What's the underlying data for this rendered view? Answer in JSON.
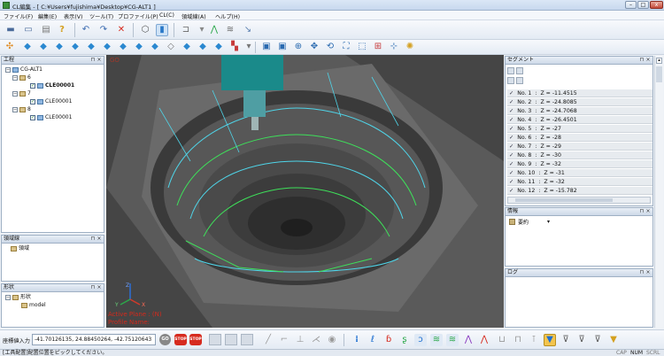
{
  "window": {
    "title": "CL編集 - [ C:¥Users¥fujishima¥Desktop¥CG-ALT1 ]",
    "min_label": "–",
    "max_label": "□",
    "close_label": "x"
  },
  "menu": [
    "ファイル(F)",
    "編集(E)",
    "表示(V)",
    "ツール(T)",
    "プロファイル(P)",
    "CL(C)",
    "領域線(A)",
    "ヘルプ(H)"
  ],
  "process_panel": {
    "title": "工程",
    "root": "CG-ALT1",
    "groups": [
      {
        "label": "6",
        "item": "CLE00001",
        "selected": true
      },
      {
        "label": "7",
        "item": "CLE00001",
        "selected": false
      },
      {
        "label": "8",
        "item": "CLE00001",
        "selected": false
      }
    ]
  },
  "area_panel": {
    "title": "領域線",
    "item": "領域"
  },
  "shape_panel": {
    "title": "形状",
    "root": "形状",
    "child": "model"
  },
  "viewport": {
    "corner_label": "GO",
    "overlay_plane": "Active Plane : (N)",
    "overlay_profile": "Profile Name:",
    "axis_x": "X",
    "axis_y": "Y",
    "axis_z": "Z"
  },
  "segment_panel": {
    "title": "セグメント",
    "rows": [
      {
        "no": "No.  1",
        "z": "Z = -11.4515"
      },
      {
        "no": "No.  2",
        "z": "Z = -24.8085"
      },
      {
        "no": "No.  3",
        "z": "Z = -24.7068"
      },
      {
        "no": "No.  4",
        "z": "Z = -26.4501"
      },
      {
        "no": "No.  5",
        "z": "Z = -27"
      },
      {
        "no": "No.  6",
        "z": "Z = -28"
      },
      {
        "no": "No.  7",
        "z": "Z = -29"
      },
      {
        "no": "No.  8",
        "z": "Z = -30"
      },
      {
        "no": "No.  9",
        "z": "Z = -32"
      },
      {
        "no": "No.  10",
        "z": "Z = -31"
      },
      {
        "no": "No.  11",
        "z": "Z = -32"
      },
      {
        "no": "No.  12",
        "z": "Z = -15.782"
      }
    ]
  },
  "info_panel": {
    "title": "情報",
    "dropdown": "要約"
  },
  "log_panel": {
    "title": "ログ"
  },
  "coord_input": {
    "label": "座標値入力",
    "value": "-41.70126135, 24.88450264, -42.75120643"
  },
  "status": {
    "message": "[工具配置]配置位置をピックしてください。",
    "cap": "CAP",
    "num": "NUM",
    "scrl": "SCRL"
  },
  "colors": {
    "stop_red": "#d62b1f",
    "accent_green": "#2ca84a",
    "accent_blue": "#1e6fd0",
    "toolpath_cyan": "#4fd4e8",
    "toolpath_green": "#3ee05a",
    "tool_teal": "#1a8a8a"
  }
}
